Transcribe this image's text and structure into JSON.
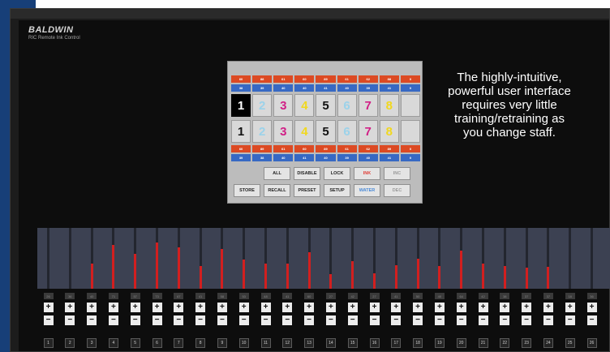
{
  "brand": {
    "name": "BALDWIN",
    "subtitle": "RIC Remote Ink Control"
  },
  "caption": "The highly-intuitive, powerful user interface requires very little training/retraining as you change staff.",
  "panel": {
    "top_value_rows": [
      {
        "color": "red",
        "values": [
          "60",
          "88",
          "61",
          "60",
          "89",
          "61",
          "62",
          "88",
          "0"
        ]
      },
      {
        "color": "blue",
        "values": [
          "38",
          "39",
          "40",
          "40",
          "41",
          "40",
          "39",
          "41",
          "0"
        ]
      }
    ],
    "digit_rows": [
      {
        "cells": [
          "1",
          "2",
          "3",
          "4",
          "5",
          "6",
          "7",
          "8",
          ""
        ],
        "selected_index": 0
      },
      {
        "cells": [
          "1",
          "2",
          "3",
          "4",
          "5",
          "6",
          "7",
          "8",
          ""
        ],
        "selected_index": -1
      }
    ],
    "digit_colors": [
      "#111111",
      "#9bd2ea",
      "#d11f86",
      "#f1d81d",
      "#111111",
      "#9bd2ea",
      "#d11f86",
      "#f1d81d",
      "#111111"
    ],
    "bottom_value_rows": [
      {
        "color": "red",
        "values": [
          "60",
          "89",
          "61",
          "60",
          "89",
          "61",
          "62",
          "89",
          "0"
        ]
      },
      {
        "color": "blue",
        "values": [
          "39",
          "38",
          "40",
          "41",
          "40",
          "39",
          "40",
          "41",
          "0"
        ]
      }
    ],
    "buttons_row1": [
      {
        "label": "ALL",
        "color": "#222222"
      },
      {
        "label": "DISABLE",
        "color": "#222222"
      },
      {
        "label": "LOCK",
        "color": "#222222"
      },
      {
        "label": "INK",
        "color": "#e0413a"
      },
      {
        "label": "INC",
        "color": "#9a9a9a"
      }
    ],
    "buttons_row2": [
      {
        "label": "STORE",
        "color": "#222222"
      },
      {
        "label": "RECALL",
        "color": "#222222"
      },
      {
        "label": "PRESET",
        "color": "#222222"
      },
      {
        "label": "SETUP",
        "color": "#222222"
      },
      {
        "label": "WATER",
        "color": "#4a8ad7"
      },
      {
        "label": "DEC",
        "color": "#9a9a9a"
      }
    ]
  },
  "keys": {
    "ink_levels": [
      0,
      0,
      0.42,
      0.72,
      0.57,
      0.76,
      0.68,
      0.38,
      0.66,
      0.48,
      0.42,
      0.41,
      0.6,
      0.24,
      0.46,
      0.25,
      0.39,
      0.5,
      0.37,
      0.63,
      0.41,
      0.37,
      0.35,
      0.36,
      0,
      0
    ],
    "readouts": [
      "26",
      "36",
      "40",
      "71",
      "57",
      "73",
      "67",
      "41",
      "58",
      "53",
      "48",
      "41",
      "60",
      "27",
      "42",
      "27",
      "41",
      "50",
      "40",
      "64",
      "42",
      "38",
      "37",
      "37",
      "18",
      "36"
    ],
    "plus_label": "+",
    "minus_label": "−",
    "numbers": [
      "1",
      "2",
      "3",
      "4",
      "5",
      "6",
      "7",
      "8",
      "9",
      "10",
      "11",
      "12",
      "13",
      "14",
      "15",
      "16",
      "17",
      "18",
      "19",
      "20",
      "21",
      "22",
      "23",
      "24",
      "25",
      "26"
    ]
  }
}
